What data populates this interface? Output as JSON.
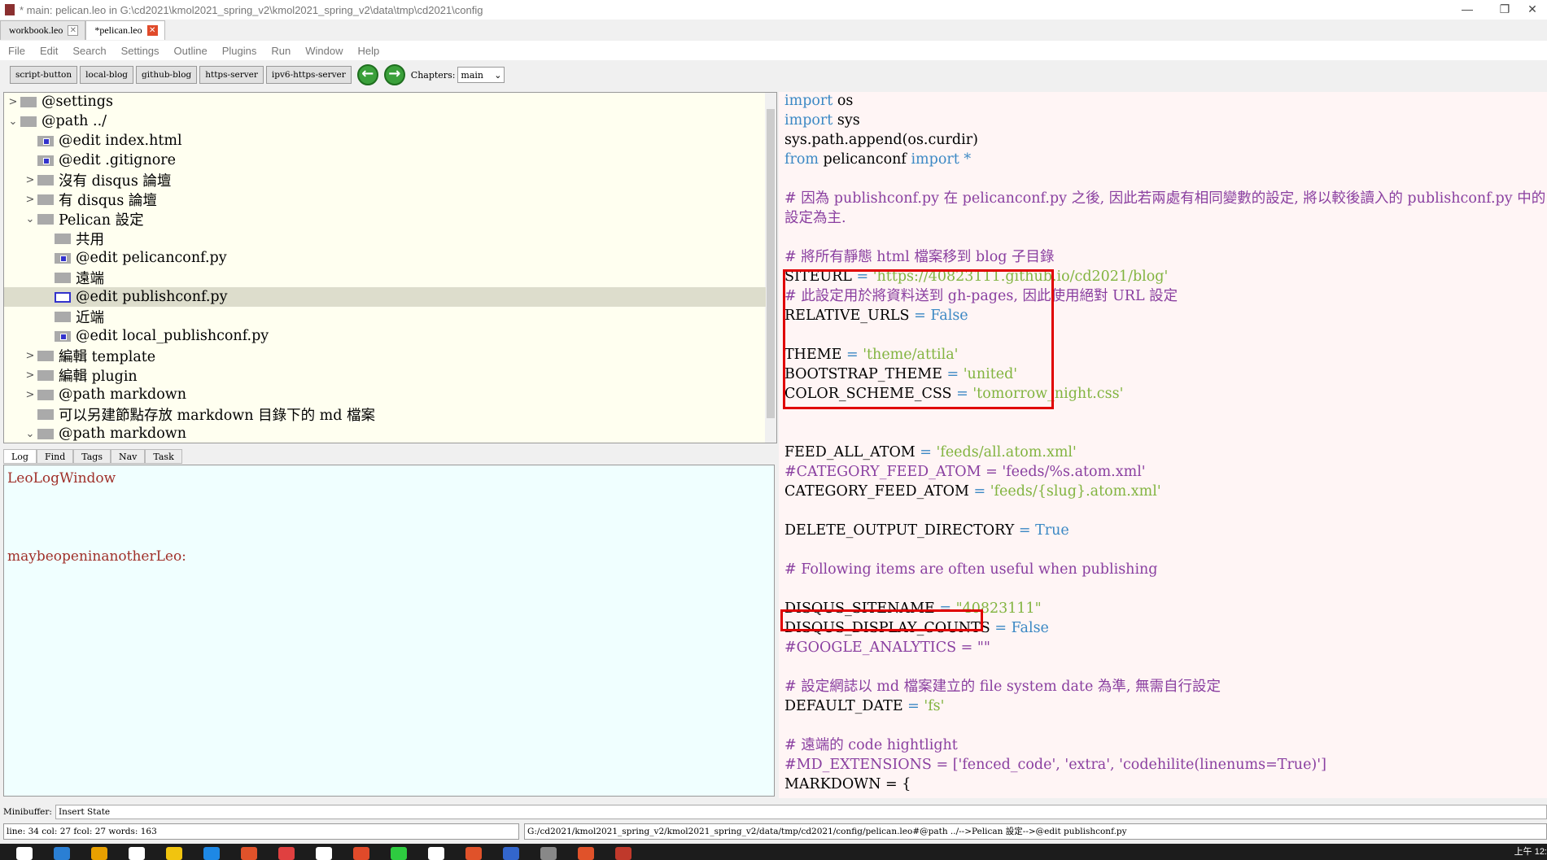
{
  "window": {
    "title": "* main: pelican.leo in G:\\cd2021\\kmol2021_spring_v2\\kmol2021_spring_v2\\data\\tmp\\cd2021\\config",
    "minimize": "—",
    "restore": "❐",
    "close": "✕"
  },
  "tabs": [
    {
      "label": "workbook.leo"
    },
    {
      "label": "*pelican.leo"
    }
  ],
  "tab_close": "✕",
  "menu": [
    "File",
    "Edit",
    "Search",
    "Settings",
    "Outline",
    "Plugins",
    "Run",
    "Window",
    "Help"
  ],
  "toolbar": {
    "buttons": [
      "script-button",
      "local-blog",
      "github-blog",
      "https-server",
      "ipv6-https-server"
    ],
    "back": "←",
    "forward": "→",
    "chapters_label": "Chapters:",
    "chapters_value": "main",
    "dropdown": "⌄"
  },
  "outline": [
    {
      "text": "@settings",
      "arrow": ">",
      "icon": "plain"
    },
    {
      "text": "@path ../",
      "arrow": "⌄",
      "icon": "plain"
    },
    {
      "text": "@edit index.html",
      "arrow": "",
      "icon": "edit"
    },
    {
      "text": "@edit .gitignore",
      "arrow": "",
      "icon": "edit"
    },
    {
      "text": "沒有 disqus 論壇",
      "arrow": ">",
      "icon": "plain"
    },
    {
      "text": "有 disqus 論壇",
      "arrow": ">",
      "icon": "plain"
    },
    {
      "text": "Pelican 設定",
      "arrow": "⌄",
      "icon": "plain"
    },
    {
      "text": "共用",
      "arrow": "",
      "icon": "plain"
    },
    {
      "text": "@edit pelicanconf.py",
      "arrow": "",
      "icon": "edit"
    },
    {
      "text": "遠端",
      "arrow": "",
      "icon": "plain"
    },
    {
      "text": "@edit publishconf.py",
      "arrow": "",
      "icon": "selected"
    },
    {
      "text": "近端",
      "arrow": "",
      "icon": "plain"
    },
    {
      "text": "@edit local_publishconf.py",
      "arrow": "",
      "icon": "edit"
    },
    {
      "text": "編輯 template",
      "arrow": ">",
      "icon": "plain"
    },
    {
      "text": "編輯 plugin",
      "arrow": ">",
      "icon": "plain"
    },
    {
      "text": "@path markdown",
      "arrow": ">",
      "icon": "plain"
    },
    {
      "text": "可以另建節點存放 markdown 目錄下的 md 檔案",
      "arrow": "",
      "icon": "plain"
    },
    {
      "text": "@path markdown",
      "arrow": "⌄",
      "icon": "plain"
    }
  ],
  "log_tabs": [
    "Log",
    "Find",
    "Tags",
    "Nav",
    "Task"
  ],
  "log_lines": [
    "LeoLogWindow",
    "maybeopeninanotherLeo:"
  ],
  "code": [
    [
      [
        "import",
        "kw"
      ],
      [
        " os",
        ""
      ]
    ],
    [
      [
        "import",
        "kw"
      ],
      [
        " sys",
        ""
      ]
    ],
    [
      [
        "sys.path.append(os.curdir)",
        ""
      ]
    ],
    [
      [
        "from",
        "kw"
      ],
      [
        " pelicanconf ",
        ""
      ],
      [
        "import *",
        "kw"
      ]
    ],
    [],
    [
      [
        "# 因為 publishconf.py 在 pelicanconf.py 之後, 因此若兩處有相同變數的設定, 將以較後讀入的 publishconf.py 中的",
        "cm"
      ]
    ],
    [
      [
        "設定為主.",
        "cm"
      ]
    ],
    [],
    [
      [
        "# 將所有靜態 html 檔案移到 blog 子目錄",
        "cm"
      ]
    ],
    [
      [
        "SITEURL",
        ""
      ],
      [
        " = ",
        "kw"
      ],
      [
        "'https://40823111.github.io/cd2021/blog'",
        "str"
      ]
    ],
    [
      [
        "# 此設定用於將資料送到 gh-pages, 因此使用絕對 URL 設定",
        "cm"
      ]
    ],
    [
      [
        "RELATIVE_URLS",
        ""
      ],
      [
        " = False",
        "kw"
      ]
    ],
    [],
    [
      [
        "THEME",
        ""
      ],
      [
        " = ",
        "kw"
      ],
      [
        "'theme/attila'",
        "str"
      ]
    ],
    [
      [
        "BOOTSTRAP_THEME",
        ""
      ],
      [
        " = ",
        "kw"
      ],
      [
        "'united'",
        "str"
      ]
    ],
    [
      [
        "COLOR_SCHEME_CSS",
        ""
      ],
      [
        " = ",
        "kw"
      ],
      [
        "'tomorrow_night.css'",
        "str"
      ]
    ],
    [],
    [],
    [
      [
        "FEED_ALL_ATOM",
        ""
      ],
      [
        " = ",
        "kw"
      ],
      [
        "'feeds/all.atom.xml'",
        "str"
      ]
    ],
    [
      [
        "#CATEGORY_FEED_ATOM = 'feeds/%s.atom.xml'",
        "cm"
      ]
    ],
    [
      [
        "CATEGORY_FEED_ATOM",
        ""
      ],
      [
        " = ",
        "kw"
      ],
      [
        "'feeds/{slug}.atom.xml'",
        "str"
      ]
    ],
    [],
    [
      [
        "DELETE_OUTPUT_DIRECTORY",
        ""
      ],
      [
        " = True",
        "kw"
      ]
    ],
    [],
    [
      [
        "# Following items are often useful when publishing",
        "cm"
      ]
    ],
    [],
    [
      [
        "DISQUS_SITENAME",
        ""
      ],
      [
        " = ",
        "kw"
      ],
      [
        "\"40823111\"",
        "str"
      ]
    ],
    [
      [
        "DISQUS_DISPLAY_COUNTS",
        ""
      ],
      [
        " = False",
        "kw"
      ]
    ],
    [
      [
        "#GOOGLE_ANALYTICS = \"\"",
        "cm"
      ]
    ],
    [],
    [
      [
        "# 設定網誌以 md 檔案建立的 file system date 為準, 無需自行設定",
        "cm"
      ]
    ],
    [
      [
        "DEFAULT_DATE",
        ""
      ],
      [
        " = ",
        "kw"
      ],
      [
        "'fs'",
        "str"
      ]
    ],
    [],
    [
      [
        "# 遠端的 code hightlight",
        "cm"
      ]
    ],
    [
      [
        "#MD_EXTENSIONS = ['fenced_code', 'extra', 'codehilite(linenums=True)']",
        "cm"
      ]
    ],
    [
      [
        "MARKDOWN = {",
        ""
      ]
    ]
  ],
  "minibuffer": {
    "label": "Minibuffer:",
    "value": "Insert State"
  },
  "status": {
    "left": "line: 34 col: 27  fcol: 27 words: 163",
    "right": "G:/cd2021/kmol2021_spring_v2/kmol2021_spring_v2/data/tmp/cd2021/config/pelican.leo#@path ../-->Pelican 設定-->@edit publishconf.py"
  },
  "taskbar": {
    "clock": "上午 12:"
  }
}
